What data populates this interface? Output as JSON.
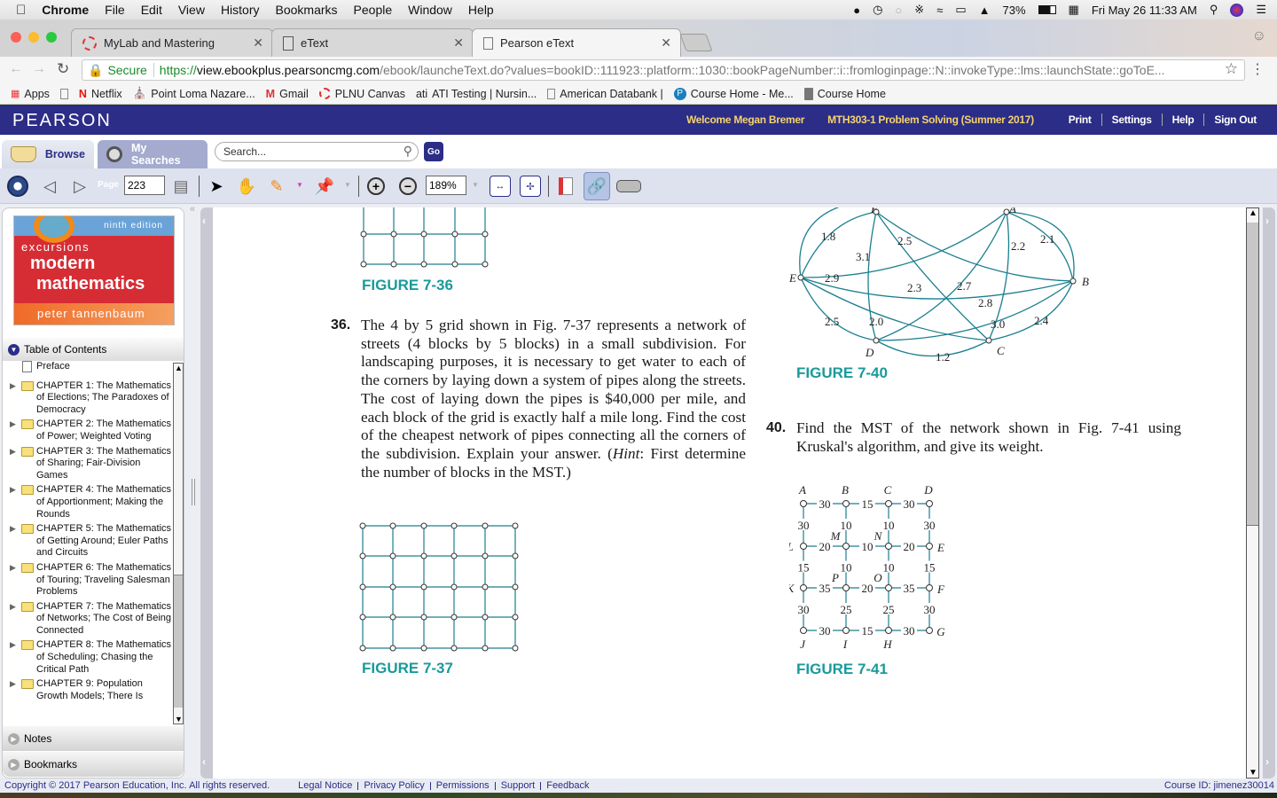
{
  "menubar": {
    "app": "Chrome",
    "items": [
      "File",
      "Edit",
      "View",
      "History",
      "Bookmarks",
      "People",
      "Window",
      "Help"
    ],
    "battery": "73%",
    "datetime": "Fri May 26  11:33 AM"
  },
  "tabs": [
    {
      "title": "MyLab and Mastering",
      "active": false
    },
    {
      "title": "eText",
      "active": false
    },
    {
      "title": "Pearson eText",
      "active": true
    }
  ],
  "address": {
    "secure_label": "Secure",
    "url_scheme": "https://",
    "url_host": "view.ebookplus.pearsoncmg.com",
    "url_path": "/ebook/launcheText.do?values=bookID::111923::platform::1030::bookPageNumber::i::fromloginpage::N::invokeType::lms::launchState::goToE..."
  },
  "bookmarks": [
    "Apps",
    "",
    "Netflix",
    "Point Loma Nazare...",
    "Gmail",
    "PLNU Canvas",
    "ATI Testing | Nursin...",
    "American Databank |",
    "Course Home - Me...",
    "Course Home"
  ],
  "header": {
    "logo": "PEARSON",
    "welcome": "Welcome Megan Bremer",
    "course": "MTH303-1 Problem Solving (Summer 2017)",
    "links": [
      "Print",
      "Settings",
      "Help",
      "Sign Out"
    ]
  },
  "browse": {
    "browse_tab": "Browse",
    "searches_tab": "My Searches",
    "search_placeholder": "Search...",
    "go": "Go"
  },
  "toolbar": {
    "page_label": "Page",
    "page_value": "223",
    "zoom_value": "189%"
  },
  "sidebar": {
    "cover": {
      "edition": "ninth edition",
      "line1": "excursions",
      "line2": "modern",
      "line3": "mathematics",
      "author": "peter tannenbaum"
    },
    "toc_title": "Table of Contents",
    "toc": [
      {
        "label": "Preface",
        "type": "doc"
      },
      {
        "label": "CHAPTER 1: The Mathematics of Elections; The Paradoxes of Democracy",
        "type": "folder"
      },
      {
        "label": "CHAPTER 2: The Mathematics of Power; Weighted Voting",
        "type": "folder"
      },
      {
        "label": "CHAPTER 3: The Mathematics of Sharing; Fair-Division Games",
        "type": "folder"
      },
      {
        "label": "CHAPTER 4: The Mathematics of Apportionment; Making the Rounds",
        "type": "folder"
      },
      {
        "label": "CHAPTER 5: The Mathematics of Getting Around; Euler Paths and Circuits",
        "type": "folder"
      },
      {
        "label": "CHAPTER 6: The Mathematics of Touring; Traveling Salesman Problems",
        "type": "folder"
      },
      {
        "label": "CHAPTER 7: The Mathematics of Networks; The Cost of Being Connected",
        "type": "folder"
      },
      {
        "label": "CHAPTER 8: The Mathematics of Scheduling; Chasing the Critical Path",
        "type": "folder"
      },
      {
        "label": "CHAPTER 9: Population Growth Models; There Is",
        "type": "folder"
      }
    ],
    "notes": "Notes",
    "bookmarks": "Bookmarks"
  },
  "content": {
    "fig736": "FIGURE 7-36",
    "p36_num": "36.",
    "p36_text": "The 4 by 5 grid shown in Fig. 7-37 represents a network of streets (4 blocks by 5 blocks) in a small subdivision. For landscaping purposes, it is necessary to get water to each of the corners by laying down a system of pipes along the streets. The cost of laying down the pipes is $40,000 per mile, and each block of the grid is exactly half a mile long. Find the cost of the cheapest network of pipes connecting all the corners of the subdivision. Explain your answer. (",
    "p36_hint": "Hint",
    "p36_tail": ": First determine the number of blocks in the MST.)",
    "fig737": "FIGURE 7-37",
    "fig740": "FIGURE 7-40",
    "p40_num": "40.",
    "p40_text": "Find the MST of the network shown in Fig. 7-41 using Kruskal's algorithm, and give its weight.",
    "fig741": "FIGURE 7-41",
    "fig740_graph": {
      "vertices": [
        "F",
        "A",
        "E",
        "B",
        "D",
        "C"
      ],
      "edges": [
        {
          "from": "E",
          "to": "F",
          "w": "1.8"
        },
        {
          "from": "F",
          "to": "B",
          "w": "2.5"
        },
        {
          "from": "F",
          "to": "D",
          "w": "3.1"
        },
        {
          "from": "F",
          "to": "C",
          "w": "2.3"
        },
        {
          "from": "A",
          "to": "B",
          "w": "2.1"
        },
        {
          "from": "A",
          "to": "C",
          "w": "2.2"
        },
        {
          "from": "A",
          "to": "E",
          "w": "2.9"
        },
        {
          "from": "A",
          "to": "D",
          "w": "2.7"
        },
        {
          "from": "E",
          "to": "B",
          "w": "2.8"
        },
        {
          "from": "E",
          "to": "D",
          "w": "2.5"
        },
        {
          "from": "E",
          "to": "C",
          "w": "2.0"
        },
        {
          "from": "D",
          "to": "B",
          "w": "3.0"
        },
        {
          "from": "C",
          "to": "B",
          "w": "2.4"
        },
        {
          "from": "D",
          "to": "C",
          "w": "1.2"
        }
      ]
    },
    "fig741_graph": {
      "rows": [
        [
          "A",
          "B",
          "C",
          "D"
        ],
        [
          "L",
          "M",
          "N",
          "E"
        ],
        [
          "K",
          "P",
          "O",
          "F"
        ],
        [
          "J",
          "I",
          "H",
          "G"
        ]
      ],
      "h_weights": [
        [
          "30",
          "15",
          "30"
        ],
        [
          "20",
          "10",
          "20"
        ],
        [
          "35",
          "20",
          "35"
        ],
        [
          "30",
          "15",
          "30"
        ]
      ],
      "v_weights": [
        [
          "30",
          "10",
          "10",
          "30"
        ],
        [
          "15",
          "10",
          "10",
          "15"
        ],
        [
          "30",
          "25",
          "25",
          "30"
        ]
      ]
    }
  },
  "footer": {
    "copyright": "Copyright © 2017 Pearson Education, Inc. All rights reserved.",
    "links": [
      "Legal Notice",
      "Privacy Policy",
      "Permissions",
      "Support",
      "Feedback"
    ],
    "course_id": "Course ID: jimenez30014"
  }
}
